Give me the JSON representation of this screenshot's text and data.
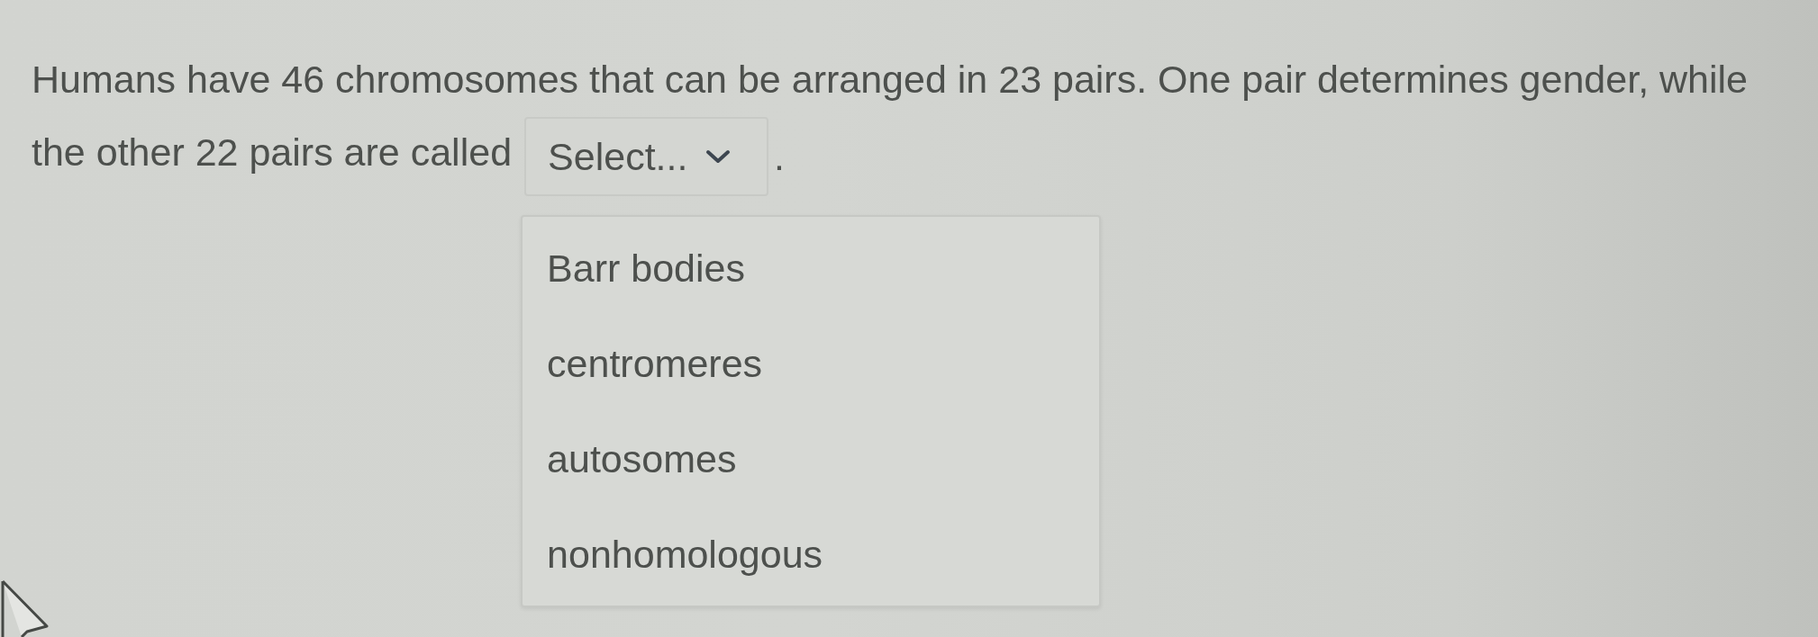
{
  "question": {
    "lines": [
      "Humans have 46 chromosomes that can be arranged in 23 pairs. One pair determines gender, while",
      "the other 22 pairs are called"
    ],
    "dropdown": {
      "placeholder": "Select...",
      "expanded": true,
      "options": [
        {
          "label": "Barr bodies",
          "selected": false
        },
        {
          "label": "centromeres",
          "selected": false
        },
        {
          "label": "autosomes",
          "selected": false
        },
        {
          "label": "nonhomologous",
          "selected": false
        }
      ]
    },
    "after": "."
  }
}
